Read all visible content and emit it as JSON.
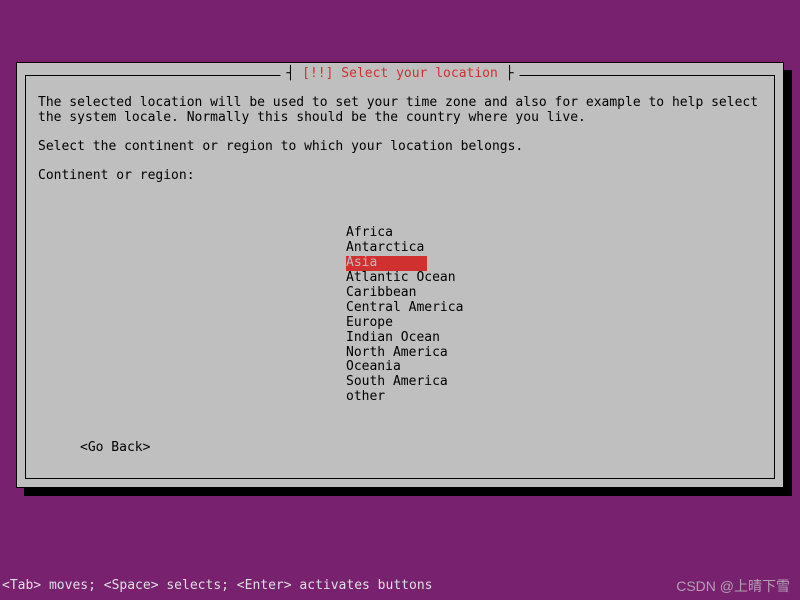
{
  "dialog": {
    "title_bracket_open": "┤ ",
    "title_marker": "[!!]",
    "title_text": " Select your location",
    "title_bracket_close": " ├",
    "paragraph1": "The selected location will be used to set your time zone and also for example to help select the system locale. Normally this should be the country where you live.",
    "paragraph2": "Select the continent or region to which your location belongs.",
    "prompt_label": "Continent or region:",
    "go_back": "<Go Back>"
  },
  "regions": {
    "items": [
      "Africa",
      "Antarctica",
      "Asia",
      "Atlantic Ocean",
      "Caribbean",
      "Central America",
      "Europe",
      "Indian Ocean",
      "North America",
      "Oceania",
      "South America",
      "other"
    ],
    "selected_index": 2
  },
  "footer": {
    "hint": "<Tab> moves; <Space> selects; <Enter> activates buttons"
  },
  "watermark": "CSDN @上晴下雪"
}
